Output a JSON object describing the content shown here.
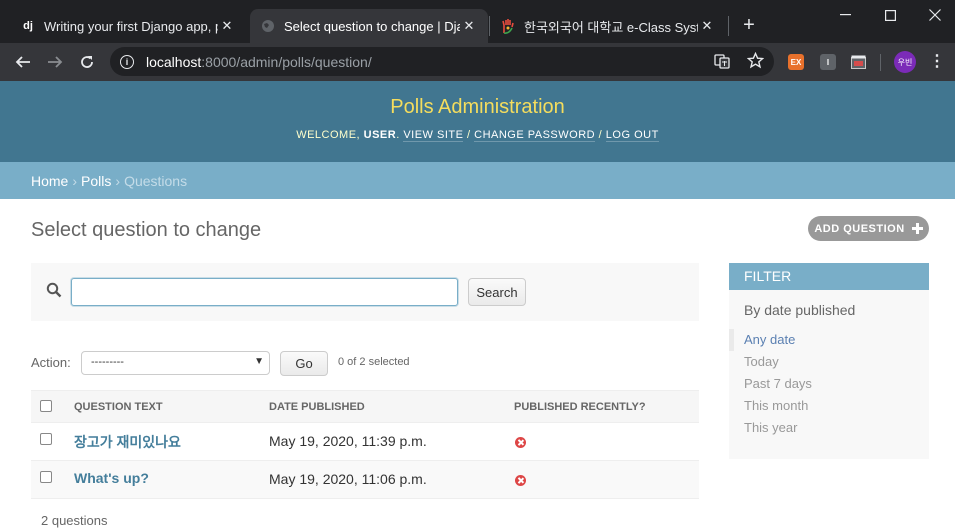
{
  "browser": {
    "tabs": [
      {
        "favicon": "dj",
        "title": "Writing your first Django app, p",
        "active": false
      },
      {
        "favicon": "globe-icon",
        "title": "Select question to change | Djan",
        "active": true
      },
      {
        "favicon": "hand-logo-icon",
        "title": "한국외국어 대학교 e-Class Syste",
        "active": false
      }
    ],
    "new_tab": "+",
    "url_host": "localhost",
    "url_rest": ":8000/admin/polls/question/",
    "extensions": [
      {
        "label": "EX",
        "color": "#e8712c"
      },
      {
        "label": "I",
        "color": "#5f6368"
      },
      {
        "label": "",
        "color": "#8a8a8a"
      }
    ],
    "profile_label": "우빈"
  },
  "header": {
    "brand": "Polls Administration",
    "welcome": "Welcome, ",
    "user": "user",
    "view_site": "View site",
    "change_password": "Change password",
    "log_out": "Log out"
  },
  "breadcrumbs": {
    "home": "Home",
    "app": "Polls",
    "current": "Questions"
  },
  "page": {
    "title": "Select question to change",
    "add_button": "ADD QUESTION"
  },
  "search": {
    "value": "",
    "button": "Search"
  },
  "actions": {
    "label": "Action:",
    "selected_option": "---------",
    "go": "Go",
    "counter": "0 of 2 selected"
  },
  "table": {
    "columns": [
      "Question text",
      "Date published",
      "Published recently?"
    ],
    "rows": [
      {
        "question": "장고가 재미있나요",
        "date": "May 19, 2020, 11:39 p.m.",
        "recent": false
      },
      {
        "question": "What's up?",
        "date": "May 19, 2020, 11:06 p.m.",
        "recent": false
      }
    ]
  },
  "paginator": "2 questions",
  "filter": {
    "heading": "FILTER",
    "title": "By date published",
    "options": [
      "Any date",
      "Today",
      "Past 7 days",
      "This month",
      "This year"
    ],
    "selected": "Any date"
  },
  "colors": {
    "header_bg": "#417690",
    "breadcrumb_bg": "#79aec8",
    "brand_text": "#f5dd5d",
    "link": "#447e9b",
    "false_icon": "#dd4646"
  }
}
